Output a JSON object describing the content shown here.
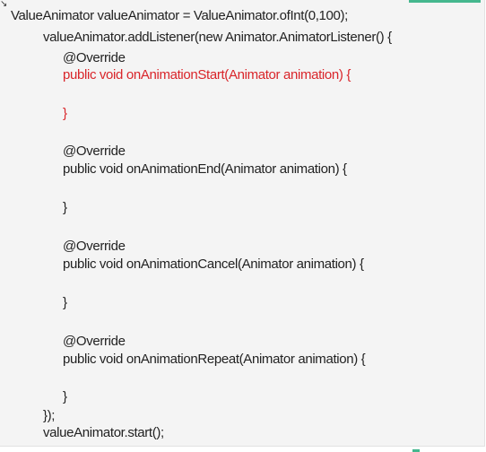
{
  "code": {
    "lines": [
      "ValueAnimator valueAnimator = ValueAnimator.ofInt(0,100);",
      "valueAnimator.addListener(new Animator.AnimatorListener() {",
      "@Override",
      "public void onAnimationStart(Animator animation) {",
      "}",
      "@Override",
      "public void onAnimationEnd(Animator animation) {",
      "}",
      "@Override",
      "public void onAnimationCancel(Animator animation) {",
      "}",
      "@Override",
      "public void onAnimationRepeat(Animator animation) {",
      "}",
      "});",
      "valueAnimator.start();"
    ]
  },
  "colors": {
    "text": "#222222",
    "highlight": "#d9252a",
    "accent": "#45b78e",
    "background": "#f4f4f4"
  }
}
